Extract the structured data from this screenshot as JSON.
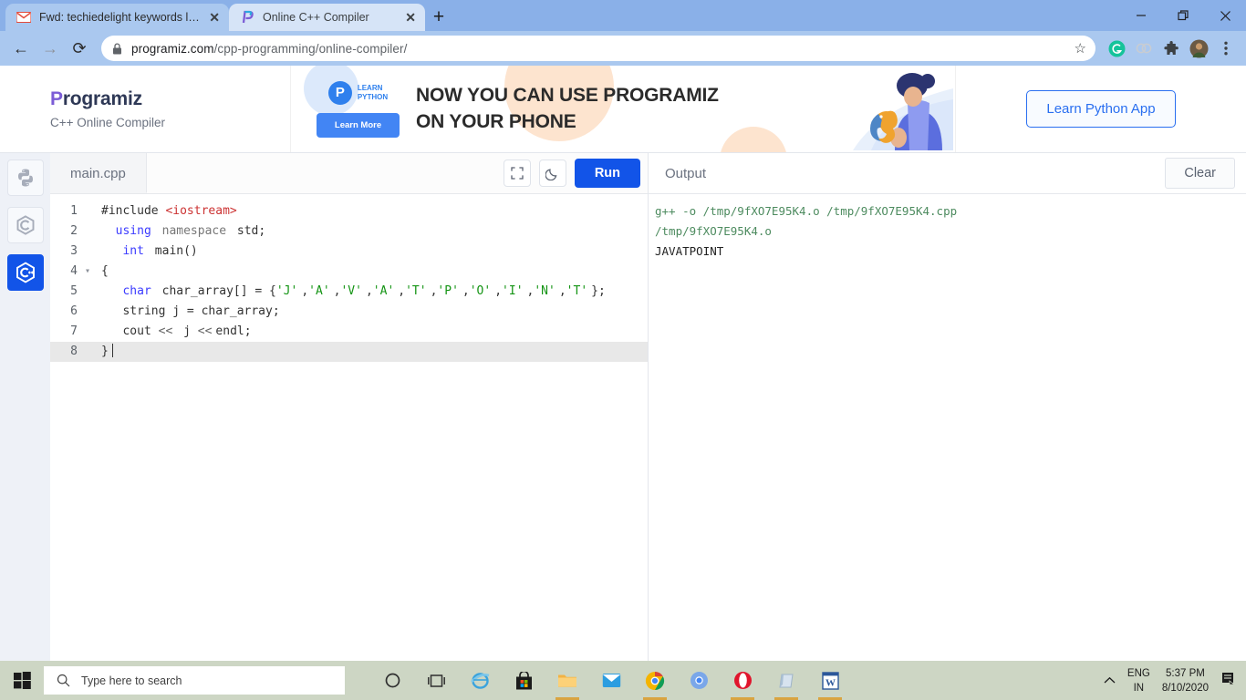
{
  "browser": {
    "tabs": [
      {
        "title": "Fwd: techiedelight keywords list -",
        "favicon": "gmail-icon",
        "active": false
      },
      {
        "title": "Online C++ Compiler",
        "favicon": "programiz-icon",
        "active": true
      }
    ],
    "new_tab_label": "+",
    "close_label": "✕",
    "window_controls": {
      "minimize": "—",
      "maximize": "❐",
      "close": "✕"
    },
    "nav": {
      "back": "←",
      "forward": "→",
      "reload": "⟳"
    },
    "omnibox": {
      "lock_icon": "lock-icon",
      "url_domain": "programiz.com",
      "url_path": "/cpp-programming/online-compiler/",
      "star_icon": "☆"
    },
    "toolbar_icons": [
      "grammarly-icon",
      "extension-icon",
      "puzzle-icon",
      "profile-avatar",
      "chrome-menu-icon"
    ]
  },
  "site": {
    "brand_logo_first": "P",
    "brand_logo_rest": "rogramiz",
    "brand_subtitle": "C++ Online Compiler",
    "app_button": "Learn Python App"
  },
  "ad": {
    "logo_badge": "P",
    "logo_line1": "LEARN",
    "logo_line2": "PYTHON",
    "cta": "Learn More",
    "headline_line1": "NOW YOU CAN USE PROGRAMIZ",
    "headline_line2": "ON YOUR PHONE"
  },
  "languages": [
    {
      "name": "python-icon",
      "label": "Python",
      "active": false
    },
    {
      "name": "c-icon",
      "label": "C",
      "active": false
    },
    {
      "name": "cpp-icon",
      "label": "C++",
      "active": true
    }
  ],
  "editor": {
    "filename": "main.cpp",
    "fullscreen_icon": "fullscreen-icon",
    "theme_icon": "moon-icon",
    "run_label": "Run",
    "cursor_line": 8,
    "lines": [
      {
        "n": 1,
        "fold": "",
        "tokens": [
          {
            "t": "#include ",
            "c": "src"
          },
          {
            "t": "<iostream>",
            "c": "inc"
          }
        ]
      },
      {
        "n": 2,
        "fold": "",
        "tokens": [
          {
            "t": "  ",
            "c": "src"
          },
          {
            "t": "using",
            "c": "kw"
          },
          {
            "t": " ",
            "c": "src"
          },
          {
            "t": "namespace",
            "c": "ns"
          },
          {
            "t": " std;",
            "c": "src"
          }
        ]
      },
      {
        "n": 3,
        "fold": "",
        "tokens": [
          {
            "t": "   ",
            "c": "src"
          },
          {
            "t": "int",
            "c": "kw"
          },
          {
            "t": " main()",
            "c": "src"
          }
        ]
      },
      {
        "n": 4,
        "fold": "▾",
        "tokens": [
          {
            "t": "{",
            "c": "src"
          }
        ]
      },
      {
        "n": 5,
        "fold": "",
        "tokens": [
          {
            "t": "   ",
            "c": "src"
          },
          {
            "t": "char",
            "c": "kw"
          },
          {
            "t": " char_array[] = {",
            "c": "src"
          },
          {
            "t": "'J'",
            "c": "str"
          },
          {
            "t": ",",
            "c": "src"
          },
          {
            "t": "'A'",
            "c": "str"
          },
          {
            "t": ",",
            "c": "src"
          },
          {
            "t": "'V'",
            "c": "str"
          },
          {
            "t": ",",
            "c": "src"
          },
          {
            "t": "'A'",
            "c": "str"
          },
          {
            "t": ",",
            "c": "src"
          },
          {
            "t": "'T'",
            "c": "str"
          },
          {
            "t": ",",
            "c": "src"
          },
          {
            "t": "'P'",
            "c": "str"
          },
          {
            "t": ",",
            "c": "src"
          },
          {
            "t": "'O'",
            "c": "str"
          },
          {
            "t": ",",
            "c": "src"
          },
          {
            "t": "'I'",
            "c": "str"
          },
          {
            "t": ",",
            "c": "src"
          },
          {
            "t": "'N'",
            "c": "str"
          },
          {
            "t": ",",
            "c": "src"
          },
          {
            "t": "'T'",
            "c": "str"
          },
          {
            "t": "};",
            "c": "src"
          }
        ]
      },
      {
        "n": 6,
        "fold": "",
        "tokens": [
          {
            "t": "   string j = char_array;",
            "c": "src"
          }
        ]
      },
      {
        "n": 7,
        "fold": "",
        "tokens": [
          {
            "t": "   cout ",
            "c": "src"
          },
          {
            "t": "<<",
            "c": "op"
          },
          {
            "t": " j ",
            "c": "src"
          },
          {
            "t": "<<",
            "c": "op"
          },
          {
            "t": "endl;",
            "c": "src"
          }
        ]
      },
      {
        "n": 8,
        "fold": "",
        "tokens": [
          {
            "t": "}",
            "c": "src"
          }
        ]
      }
    ]
  },
  "output": {
    "title": "Output",
    "clear_label": "Clear",
    "lines": [
      {
        "text": "g++ -o /tmp/9fXO7E95K4.o /tmp/9fXO7E95K4.cpp",
        "kind": "cmd"
      },
      {
        "text": "/tmp/9fXO7E95K4.o",
        "kind": "cmd"
      },
      {
        "text": "JAVATPOINT",
        "kind": "res"
      }
    ]
  },
  "taskbar": {
    "start_icon": "windows-start-icon",
    "search_placeholder": "Type here to search",
    "search_icon": "search-icon",
    "items": [
      {
        "name": "cortana-icon",
        "open": false
      },
      {
        "name": "task-view-icon",
        "open": false
      },
      {
        "name": "internet-explorer-icon",
        "open": false
      },
      {
        "name": "microsoft-store-icon",
        "open": false
      },
      {
        "name": "file-explorer-icon",
        "open": true
      },
      {
        "name": "mail-icon",
        "open": false
      },
      {
        "name": "chrome-icon",
        "open": true
      },
      {
        "name": "chrome-canary-icon",
        "open": false
      },
      {
        "name": "opera-icon",
        "open": true
      },
      {
        "name": "notepad-icon",
        "open": true
      },
      {
        "name": "word-icon",
        "open": true
      }
    ],
    "tray": {
      "chevron": "ⱏ",
      "lang_line1": "ENG",
      "lang_line2": "IN",
      "time": "5:37 PM",
      "date": "8/10/2020",
      "notification_icon": "notification-icon"
    }
  },
  "colors": {
    "accent_blue": "#1254e8",
    "chrome_tabstrip": "#8ab0e8",
    "chrome_toolbar": "#aac8ef",
    "taskbar": "#cdd6c4",
    "output_green": "#4d8b5f"
  }
}
